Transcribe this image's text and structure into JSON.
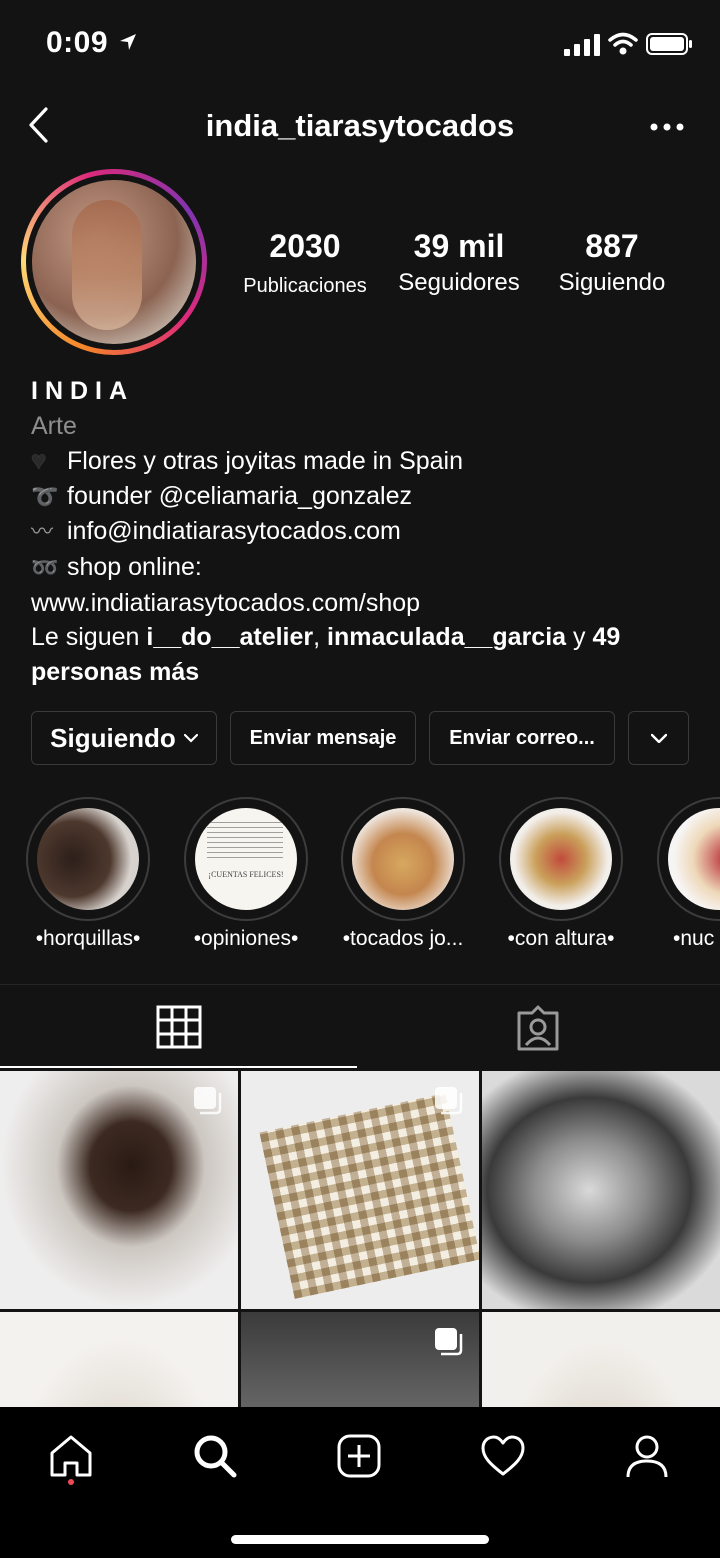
{
  "status_bar": {
    "time": "0:09"
  },
  "header": {
    "username": "india_tiarasytocados"
  },
  "stats": [
    {
      "value": "2030",
      "label": "Publicaciones"
    },
    {
      "value": "39 mil",
      "label": "Seguidores"
    },
    {
      "value": "887",
      "label": "Siguiendo"
    }
  ],
  "bio": {
    "name": "INDIA",
    "category": "Arte",
    "line1": "Flores y otras joyitas made in Spain",
    "line2": "founder @celiamaria_gonzalez",
    "line3": "info@indiatiarasytocados.com",
    "line4": "shop online:",
    "website": "www.indiatiarasytocados.com/shop",
    "followed_prefix": "Le siguen ",
    "followed_user1": "i__do__atelier",
    "followed_sep": ", ",
    "followed_user2": "inmaculada__garcia",
    "followed_mid": " y ",
    "followed_more": "49 personas más"
  },
  "buttons": {
    "following": "Siguiendo",
    "message": "Enviar mensaje",
    "email": "Enviar correo..."
  },
  "highlights": [
    {
      "label": "•horquillas•"
    },
    {
      "label": "•opiniones•"
    },
    {
      "label": "•tocados jo..."
    },
    {
      "label": "•con altura•"
    },
    {
      "label": "•nuc"
    }
  ],
  "highlight_opinion_caption": "¡CUENTAS FELICES!",
  "colors": {
    "background": "#131313",
    "notification_dot": "#ed4956",
    "border": "#3a3a3a"
  },
  "icons": [
    "back-icon",
    "more-icon",
    "grid-icon",
    "tagged-icon",
    "home-icon",
    "search-icon",
    "add-icon",
    "heart-icon",
    "profile-icon"
  ]
}
